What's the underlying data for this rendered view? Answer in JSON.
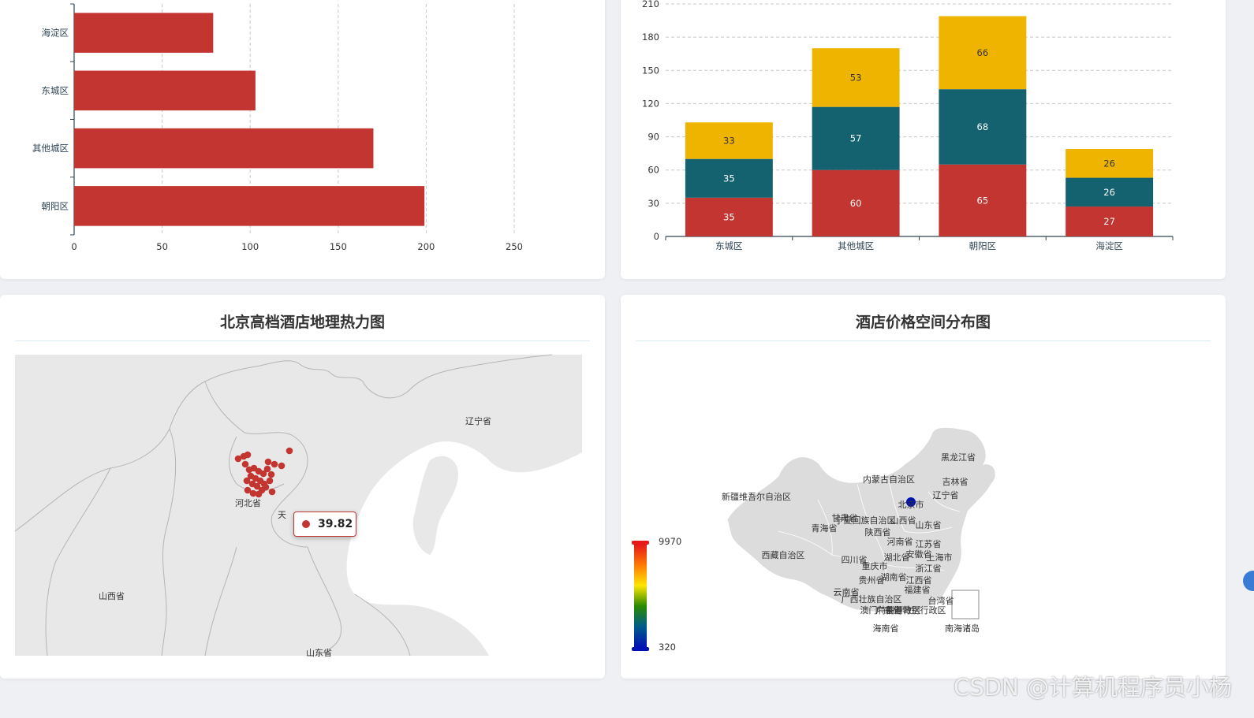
{
  "colors": {
    "red": "#c23531",
    "teal": "#146170",
    "yellow": "#efb400",
    "axis": "#2f4554",
    "visual_high": "#e6181a",
    "visual_low": "#0012b3"
  },
  "chart_data": [
    {
      "type": "bar",
      "orientation": "horizontal",
      "categories": [
        "朝阳区",
        "其他城区",
        "东城区",
        "海淀区"
      ],
      "values": [
        199,
        170,
        103,
        79
      ],
      "xlim": [
        0,
        250
      ],
      "xticks": [
        "0",
        "50",
        "100",
        "150",
        "200",
        "250"
      ],
      "grid": "vertical-dashed",
      "color": "#c23531"
    },
    {
      "type": "bar",
      "stacked": true,
      "categories": [
        "东城区",
        "其他城区",
        "朝阳区",
        "海淀区"
      ],
      "series": [
        {
          "values": [
            35,
            60,
            65,
            27
          ],
          "color": "#c23531"
        },
        {
          "values": [
            35,
            57,
            68,
            26
          ],
          "color": "#146170"
        },
        {
          "values": [
            33,
            53,
            66,
            26
          ],
          "color": "#efb400"
        }
      ],
      "ylim": [
        0,
        210
      ],
      "yticks": [
        "0",
        "30",
        "60",
        "90",
        "120",
        "150",
        "180",
        "210"
      ],
      "grid": "horizontal-dashed"
    }
  ],
  "heatmap": {
    "title": "北京高档酒店地理热力图",
    "labels": [
      "辽宁省",
      "河北省",
      "天",
      "山西省",
      "山东省"
    ],
    "tooltip_value": "39.82",
    "point_color": "#c23531"
  },
  "china_map": {
    "title": "酒店价格空间分布图",
    "visual_map": {
      "max": "9970",
      "min": "320"
    },
    "labels": [
      "黑龙江省",
      "内蒙古自治区",
      "吉林省",
      "辽宁省",
      "新疆维吾尔自治区",
      "北京市",
      "甘肃省",
      "宁夏回族自治区",
      "山西省",
      "青海省",
      "山东省",
      "陕西省",
      "河南省",
      "江苏省",
      "西藏自治区",
      "四川省",
      "湖北省",
      "安徽省",
      "上海市",
      "重庆市",
      "浙江省",
      "贵州省",
      "湖南省",
      "江西省",
      "福建省",
      "云南省",
      "广西壮族自治区",
      "台湾省",
      "广东省",
      "澳门特别行政区",
      "香港特别行政区",
      "海南省",
      "南海诸岛"
    ]
  },
  "watermark": "CSDN @计算机程序员小杨"
}
